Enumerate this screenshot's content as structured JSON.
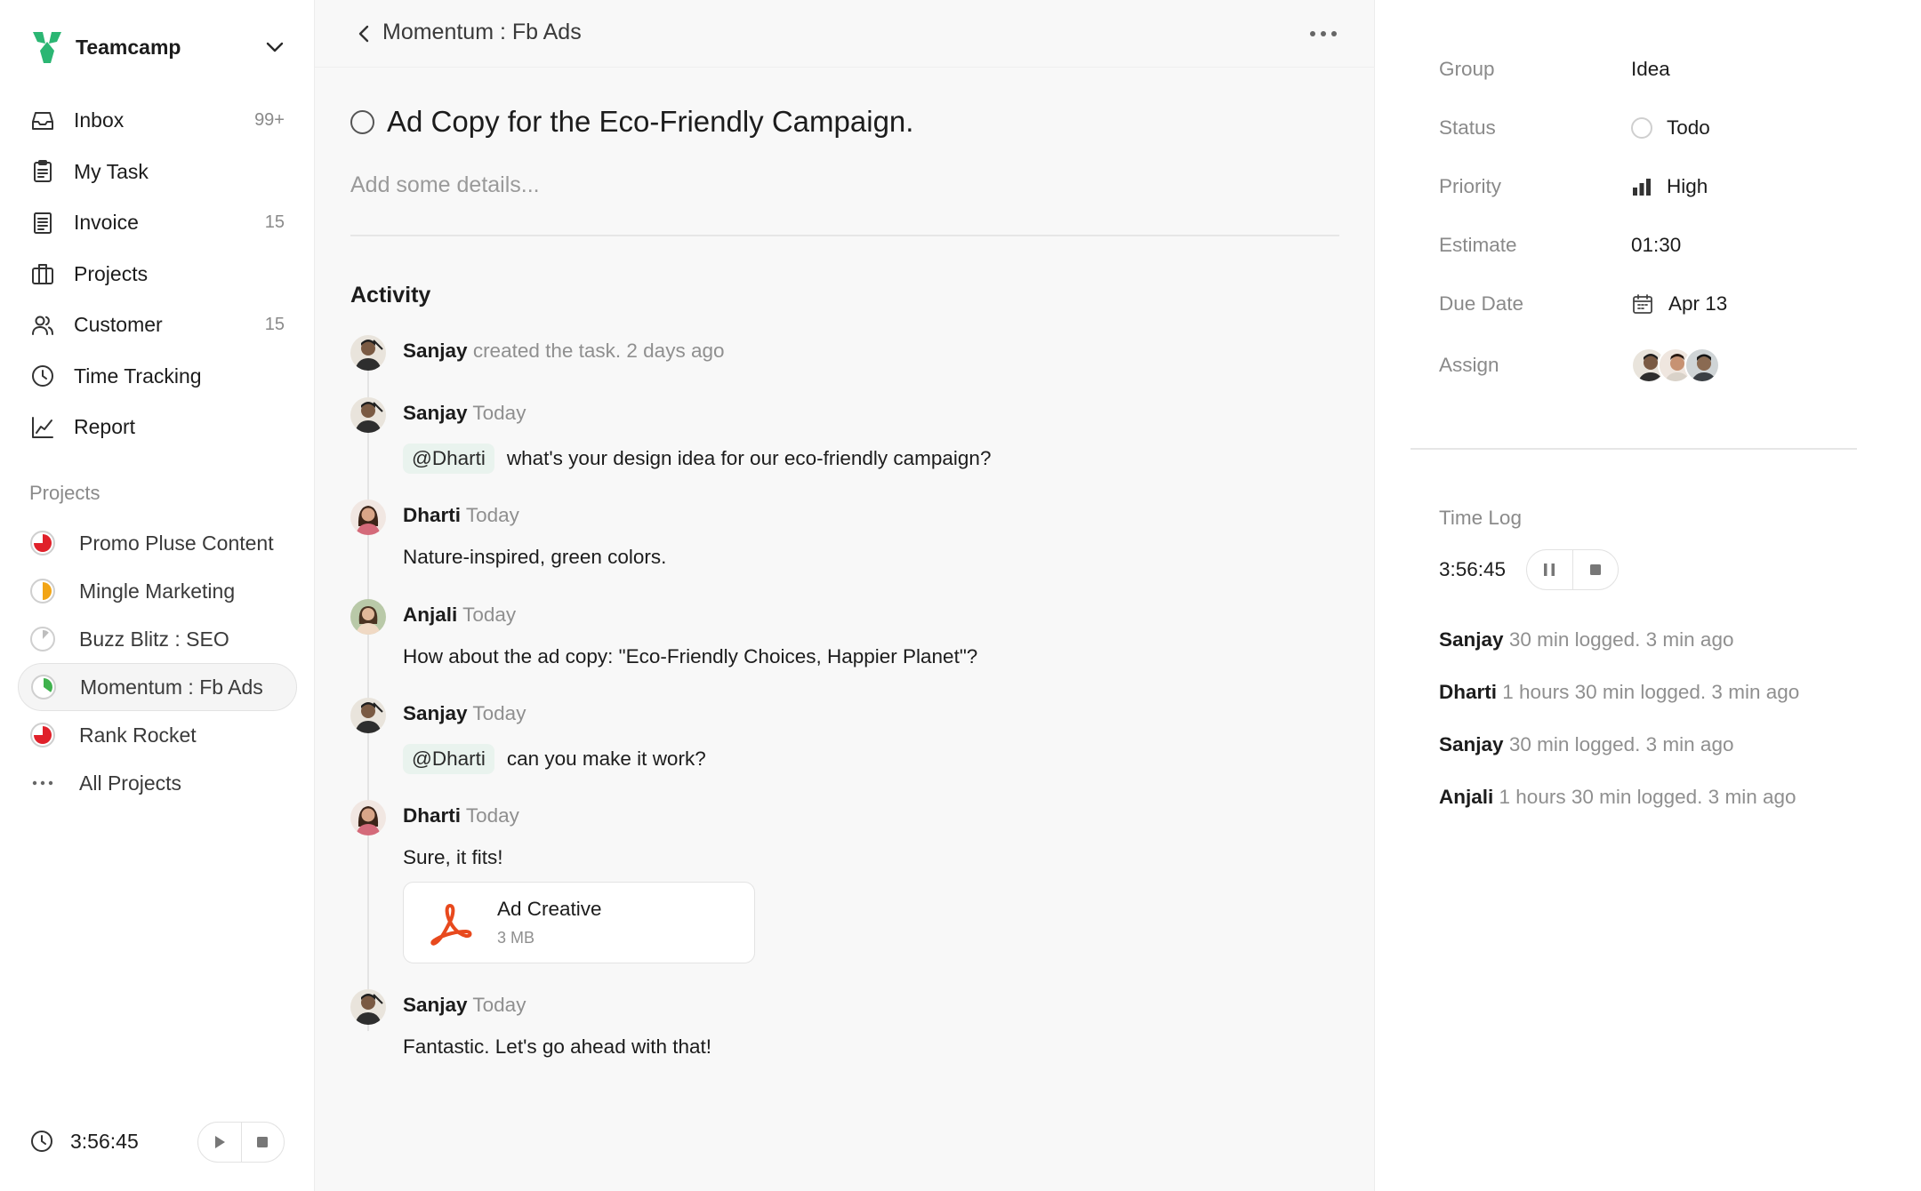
{
  "app": {
    "name": "Teamcamp"
  },
  "nav": [
    {
      "label": "Inbox",
      "count": "99+",
      "icon": "inbox-icon"
    },
    {
      "label": "My Task",
      "count": "",
      "icon": "clipboard-icon"
    },
    {
      "label": "Invoice",
      "count": "15",
      "icon": "invoice-icon"
    },
    {
      "label": "Projects",
      "count": "",
      "icon": "briefcase-icon"
    },
    {
      "label": "Customer",
      "count": "15",
      "icon": "users-icon"
    },
    {
      "label": "Time Tracking",
      "count": "",
      "icon": "clock-icon"
    },
    {
      "label": "Report",
      "count": "",
      "icon": "chart-line-icon"
    }
  ],
  "projects": {
    "heading": "Projects",
    "items": [
      {
        "label": "Promo Pluse Content",
        "progress": 0.75,
        "color": "#e0202a"
      },
      {
        "label": "Mingle Marketing",
        "progress": 0.5,
        "color": "#f2a516"
      },
      {
        "label": "Buzz Blitz : SEO",
        "progress": 0.12,
        "color": "#bdbdbd"
      },
      {
        "label": "Momentum : Fb Ads",
        "progress": 0.35,
        "color": "#3fb24d"
      },
      {
        "label": "Rank Rocket",
        "progress": 0.75,
        "color": "#e0202a"
      }
    ],
    "all_label": "All Projects"
  },
  "sidebar_timer": {
    "value": "3:56:45"
  },
  "header": {
    "breadcrumb": "Momentum : Fb Ads"
  },
  "task": {
    "title": "Ad Copy for the Eco-Friendly Campaign.",
    "details_placeholder": "Add some details..."
  },
  "activity": {
    "heading": "Activity",
    "items": [
      {
        "who": "Sanjay",
        "meta": "created the task. 2 days ago",
        "mention": "",
        "text": ""
      },
      {
        "who": "Sanjay",
        "meta": "Today",
        "mention": "@Dharti",
        "text": "what's your design idea for our eco-friendly campaign?"
      },
      {
        "who": "Dharti",
        "meta": "Today",
        "mention": "",
        "text": "Nature-inspired, green colors."
      },
      {
        "who": "Anjali",
        "meta": "Today",
        "mention": "",
        "text": "How about the ad copy: \"Eco-Friendly Choices, Happier Planet\"?"
      },
      {
        "who": "Sanjay",
        "meta": "Today",
        "mention": "@Dharti",
        "text": "can you make it work?"
      },
      {
        "who": "Dharti",
        "meta": "Today",
        "mention": "",
        "text": "Sure, it fits!"
      },
      {
        "who": "Sanjay",
        "meta": "Today",
        "mention": "",
        "text": "Fantastic. Let's go ahead with that!"
      }
    ],
    "attachment": {
      "name": "Ad Creative",
      "size": "3 MB"
    }
  },
  "properties": {
    "group_label": "Group",
    "group_value": "Idea",
    "status_label": "Status",
    "status_value": "Todo",
    "priority_label": "Priority",
    "priority_value": "High",
    "estimate_label": "Estimate",
    "estimate_value": "01:30",
    "due_label": "Due Date",
    "due_value": "Apr 13",
    "assign_label": "Assign"
  },
  "time_log": {
    "heading": "Time Log",
    "value": "3:56:45",
    "entries": [
      {
        "who": "Sanjay",
        "meta": "30 min logged. 3 min ago"
      },
      {
        "who": "Dharti",
        "meta": "1 hours 30 min logged. 3 min ago"
      },
      {
        "who": "Sanjay",
        "meta": "30 min logged. 3 min ago"
      },
      {
        "who": "Anjali",
        "meta": "1 hours 30 min logged. 3 min ago"
      }
    ]
  },
  "colors": {
    "brand": "#2bb673",
    "accent": "#e95420",
    "mention_bg": "#e9f3ee"
  }
}
